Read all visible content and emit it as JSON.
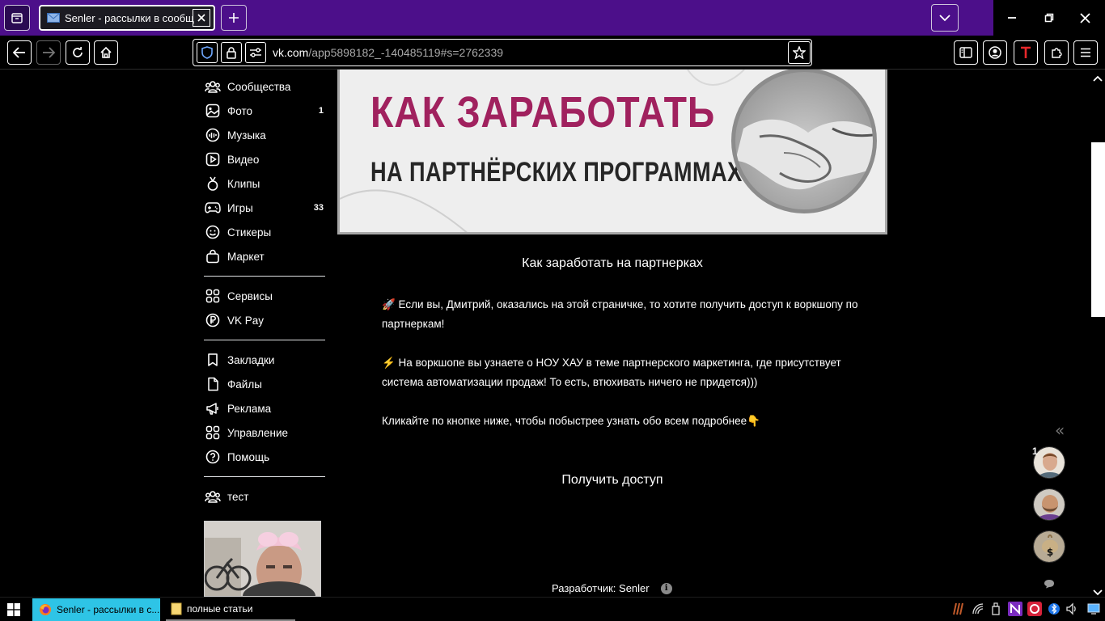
{
  "browser": {
    "tab_title": "Senler - рассылки в сообщест",
    "url_host": "vk.com",
    "url_path": "/app5898182_-140485119#s=2762339"
  },
  "sidebar": {
    "items": [
      {
        "label": "Сообщества",
        "icon": "communities-icon"
      },
      {
        "label": "Фото",
        "icon": "photo-icon",
        "count": "1"
      },
      {
        "label": "Музыка",
        "icon": "music-icon"
      },
      {
        "label": "Видео",
        "icon": "video-icon"
      },
      {
        "label": "Клипы",
        "icon": "clips-icon"
      },
      {
        "label": "Игры",
        "icon": "games-icon",
        "count": "33"
      },
      {
        "label": "Стикеры",
        "icon": "stickers-icon"
      },
      {
        "label": "Маркет",
        "icon": "market-icon"
      },
      {
        "label": "Сервисы",
        "icon": "services-icon"
      },
      {
        "label": "VK Pay",
        "icon": "vkpay-icon"
      },
      {
        "label": "Закладки",
        "icon": "bookmarks-icon"
      },
      {
        "label": "Файлы",
        "icon": "files-icon"
      },
      {
        "label": "Реклама",
        "icon": "ads-icon"
      },
      {
        "label": "Управление",
        "icon": "manage-icon"
      },
      {
        "label": "Помощь",
        "icon": "help-icon"
      },
      {
        "label": "тест",
        "icon": "communities-icon"
      }
    ]
  },
  "banner": {
    "line1": "КАК ЗАРАБОТАТЬ",
    "line2": "НА ПАРТНЁРСКИХ ПРОГРАММАХ",
    "accent_color": "#a0215e"
  },
  "content": {
    "title": "Как заработать на партнерках",
    "para1": "🚀 Если вы, Дмитрий, оказались на этой страничке, то хотите получить доступ к воркшопу по партнеркам!",
    "para2": "⚡ На воркшопе вы узнаете о НОУ ХАУ в теме партнерского маркетинга, где присутствует система автоматизации продаж! То есть, втюхивать ничего не придется)))",
    "para3": "Кликайте по кнопке ниже, чтобы побыстрее узнать обо всем подробнее👇",
    "cta_label": "Получить доступ",
    "developer": "Разработчик: Senler"
  },
  "chats": {
    "badge": "1"
  },
  "taskbar": {
    "firefox_label": "Senler - рассылки в с...",
    "folder_label": "полные статьи"
  }
}
